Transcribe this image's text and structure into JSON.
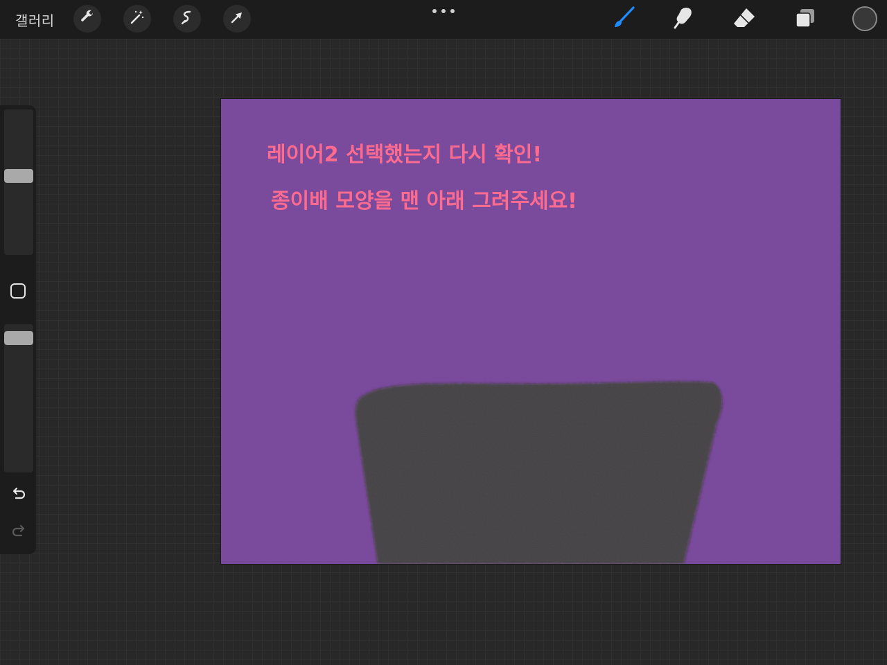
{
  "toolbar": {
    "gallery_label": "갤러리",
    "left_tools": [
      {
        "name": "wrench-icon",
        "label": "actions"
      },
      {
        "name": "magic-wand-icon",
        "label": "adjustments"
      },
      {
        "name": "selection-icon",
        "label": "selection"
      },
      {
        "name": "transform-arrow-icon",
        "label": "transform"
      }
    ],
    "right_tools": [
      {
        "name": "brush-icon",
        "active": true
      },
      {
        "name": "smudge-icon",
        "active": false
      },
      {
        "name": "eraser-icon",
        "active": false
      },
      {
        "name": "layers-icon",
        "active": false
      }
    ],
    "active_color": "#1f8cff",
    "current_color": "#383838"
  },
  "sidebar": {
    "brush_size_level": 0.55,
    "opacity_level": 0.95
  },
  "canvas": {
    "background_color": "#7a4a9c",
    "text_color": "#ff6b8e",
    "line1": "레이어2  선택했는지  다시  확인!",
    "line2": "종이배  모양을  맨  아래  그려주세요!",
    "shape_color": "#3c3b3e"
  }
}
